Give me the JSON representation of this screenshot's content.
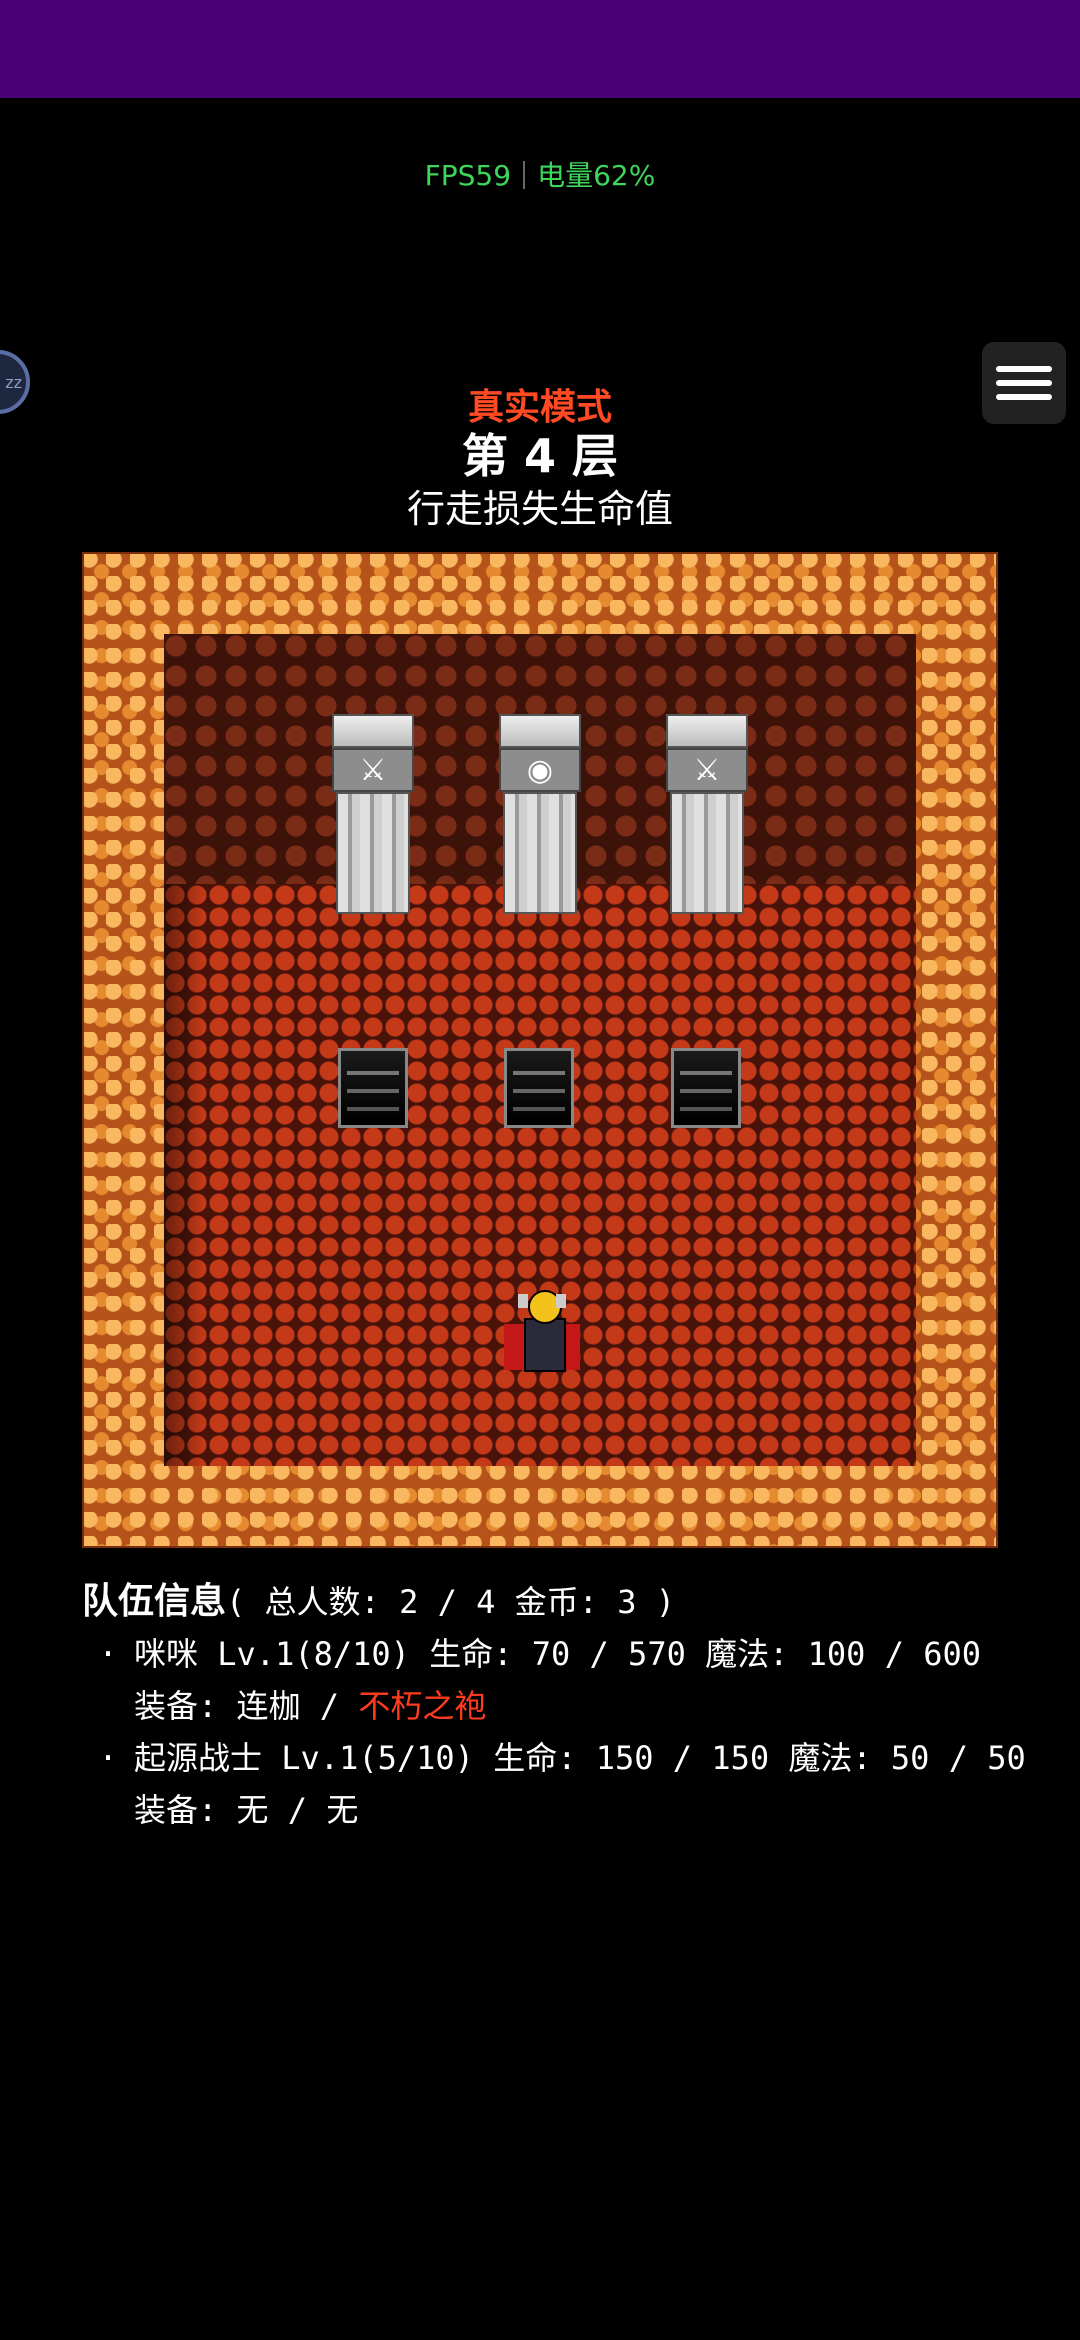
{
  "status": {
    "fps": "FPS59",
    "battery": "电量62%"
  },
  "side_badge": "zz",
  "mode_label": "真实模式",
  "floor_label": "第 4 层",
  "floor_rule": "行走损失生命值",
  "map": {
    "pillars": [
      {
        "icon": "sword-icon",
        "glyph": "🗡"
      },
      {
        "icon": "bag-icon",
        "glyph": "👝"
      },
      {
        "icon": "sword-icon",
        "glyph": "🗡"
      }
    ],
    "stairs_count": 3
  },
  "party": {
    "title": "队伍信息",
    "summary": "( 总人数: 2 / 4 金币: 3 )",
    "members": [
      {
        "line": "咪咪 Lv.1(8/10) 生命: 70 / 570 魔法: 100 / 600",
        "equip_prefix": "装备: 连枷 / ",
        "equip_highlight": "不朽之袍"
      },
      {
        "line": "起源战士 Lv.1(5/10) 生命: 150 / 150 魔法: 50 / 50",
        "equip_prefix": "装备: 无 / 无",
        "equip_highlight": ""
      }
    ]
  },
  "colors": {
    "status_bar": "#4b0077",
    "fps_green": "#3dd65a",
    "mode_red": "#ff4a24",
    "highlight_red": "#ff3b1f"
  }
}
